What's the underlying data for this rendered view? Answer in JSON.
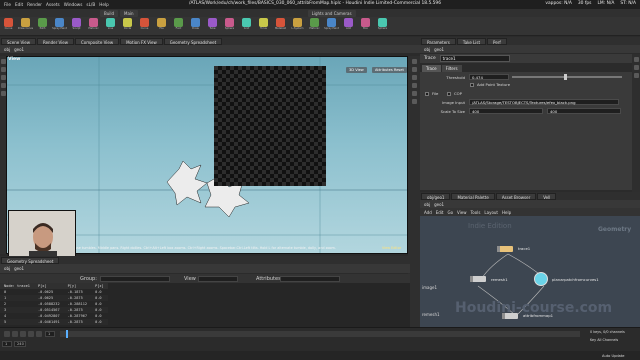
{
  "menubar": {
    "items": [
      "File",
      "Edit",
      "Render",
      "Assets",
      "Windows",
      "sL/B",
      "Help"
    ],
    "title": "/ATLAS/Work/edu/ch/work_files/BASICS_030_060_attribFromMap.hiplc - Houdini Indie Limited-Commercial 18.5.596",
    "user": "vappos: N/A",
    "fps": "30 fps",
    "mem": "LM: N/A",
    "status": "ST: N/A"
  },
  "desk_tabs": [
    "Build",
    "Main",
    "Lights and Cameras"
  ],
  "shelf_tools": [
    "Curve",
    "Draw Curve",
    "Path",
    "Spray Paint",
    "Sculpt",
    "Platonic",
    "Line",
    "Circle",
    "Curve",
    "File",
    "Font",
    "Draw",
    "Tube",
    "Sphere",
    "Grid",
    "Torus",
    "Metaball",
    "L-System",
    "Platonic",
    "Spray Paint",
    "Add",
    "Box",
    "Sphere"
  ],
  "scene_view": {
    "tabs": [
      "Scene View",
      "Render View",
      "Composite View",
      "Motion FX View",
      "Geometry Spreadsheet"
    ],
    "path": [
      "obj",
      "geo1"
    ],
    "label": "View",
    "camera_menu": "3D View",
    "cam_menu2": "Attributes Reset",
    "hint": "Left mouse tumbles. Middle pans. Right dollies. Ctrl+Alt+Left box zooms. Ctrl+Right zooms. Spacebar-Ctrl-Left tilts. Hold L for alternate tumble, dolly, and zoom.",
    "view_name": "View Editor"
  },
  "spreadsheet": {
    "tabs": [
      "Geometry Spreadsheet"
    ],
    "path": [
      "obj",
      "geo1"
    ],
    "node_label": "trace1",
    "group_label": "Group:",
    "view_label": "View",
    "attrib_label": "Attributes:",
    "columns": [
      "Node: trace1",
      "P[x]",
      "P[y]",
      "P[z]"
    ],
    "rows": [
      [
        "0",
        "-0.0625",
        "-0.1875",
        "0.0"
      ],
      [
        "1",
        "-0.0625",
        "-0.2875",
        "0.0"
      ],
      [
        "2",
        "-0.0588232",
        "-0.288112",
        "0.0"
      ],
      [
        "3",
        "-0.0514567",
        "-0.2875",
        "0.0"
      ],
      [
        "4",
        "-0.0492807",
        "-0.287967",
        "0.0"
      ],
      [
        "5",
        "-0.0461491",
        "-0.2875",
        "0.0"
      ]
    ]
  },
  "timeline": {
    "frame": "1",
    "start": "1",
    "end": "240",
    "keys_label": "0 keys, 0/0 channels",
    "key_all": "Key All Channels",
    "auto_update": "Auto Update"
  },
  "params": {
    "tabs": [
      "Parameters",
      "Take List",
      "Perf"
    ],
    "path": [
      "obj",
      "geo1"
    ],
    "node_type": "Trace",
    "node_name": "trace1",
    "param_tabs": [
      "Trace",
      "Filters"
    ],
    "threshold_label": "Threshold",
    "threshold_value": "0.474",
    "threshold_fraction": 0.47,
    "add_point_texture": "Add Point Texture",
    "file_label": "File",
    "cop_label": "COP",
    "image_input_label": "Image Input",
    "image_input_value": "/ATLAS/Storage/TESTOBJECTS/Textures/efex_black.png",
    "scale_label": "Scale To Size",
    "scale_x": "400",
    "scale_y": "400"
  },
  "network": {
    "tabs": [
      "obj/geo1",
      "Material Palette",
      "Asset Browser",
      "Vell"
    ],
    "path": [
      "obj",
      "geo1"
    ],
    "menu": [
      "Add",
      "Edit",
      "Go",
      "View",
      "Tools",
      "Layout",
      "Help"
    ],
    "watermark_indie": "Indie Edition",
    "watermark_context": "Geometry",
    "watermark_site": "Houdini-course.com",
    "nodes": [
      {
        "name": "trace1",
        "color": "#e8c27a"
      },
      {
        "name": "remesh1",
        "color": "#cfcfcf"
      },
      {
        "name": "planarpatchfromcurves1",
        "color": "#6ad3e8"
      },
      {
        "name": "attribfrommap1",
        "color": "#cfcfcf"
      }
    ],
    "side_labels": [
      "image1",
      "remesh1"
    ]
  },
  "colors": {
    "viewport_top": "#6aa6b8",
    "viewport_bottom": "#b2d6de",
    "network_bg": "#3d4651",
    "accent": "#5ab0ff"
  }
}
